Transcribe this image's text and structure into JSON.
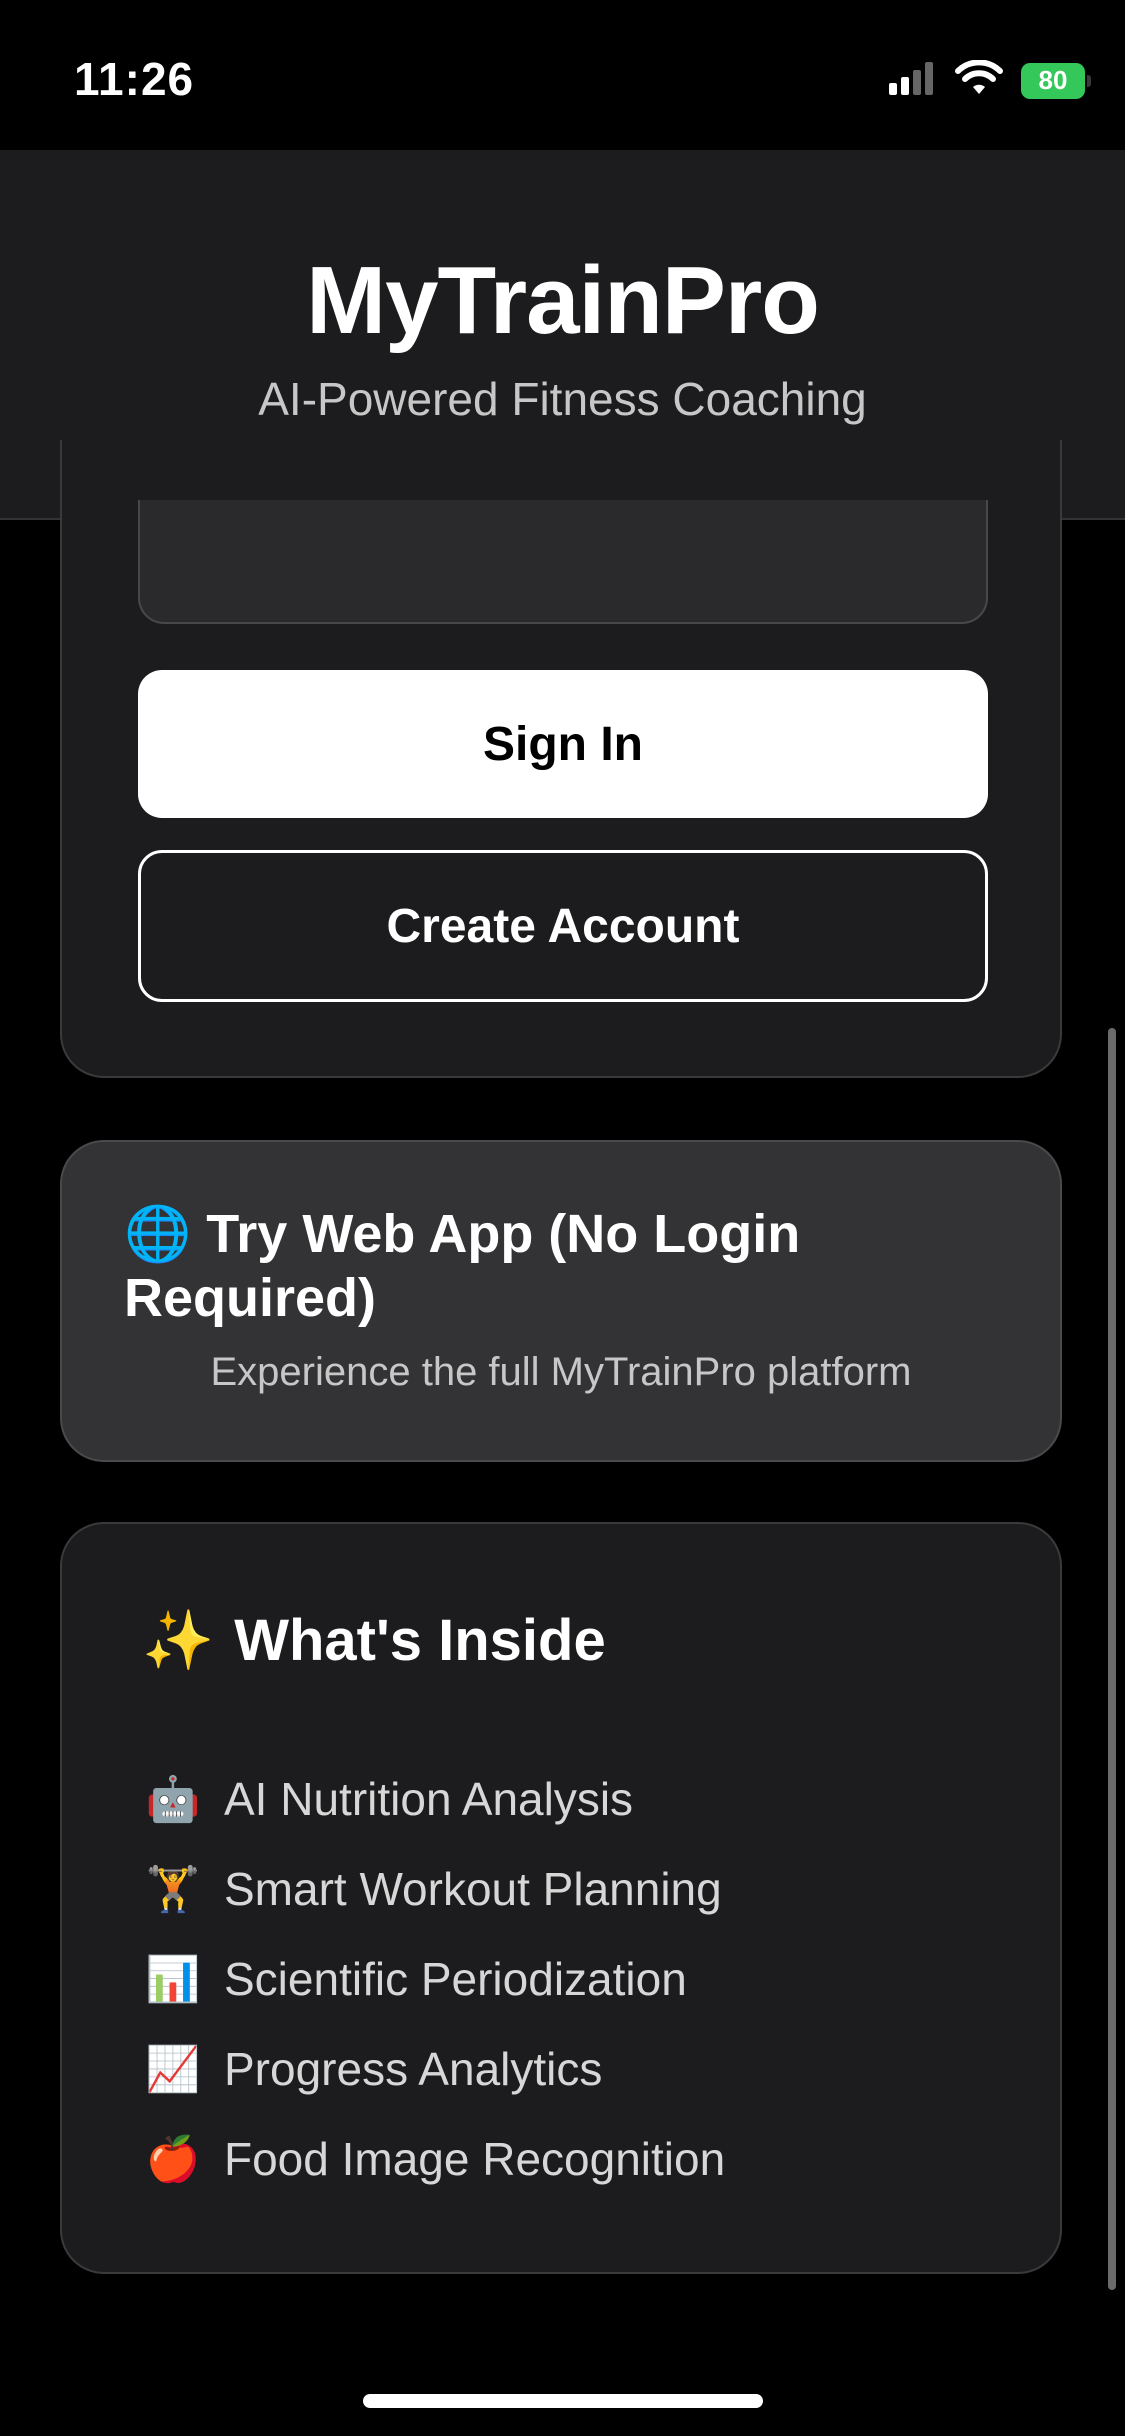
{
  "status": {
    "time": "11:26",
    "battery": "80",
    "signal_icon": "signal-bars-icon",
    "wifi_icon": "wifi-icon"
  },
  "header": {
    "title": "MyTrainPro",
    "subtitle": "AI-Powered Fitness Coaching"
  },
  "login": {
    "sign_in": "Sign In",
    "create_account": "Create Account"
  },
  "webapp": {
    "icon": "🌐",
    "title": "Try Web App (No Login Required)",
    "subtitle": "Experience the full MyTrainPro platform"
  },
  "features": {
    "icon": "✨",
    "title": "What's Inside",
    "items": [
      {
        "icon": "🤖",
        "label": "AI Nutrition Analysis"
      },
      {
        "icon": "🏋",
        "label": "Smart Workout Planning"
      },
      {
        "icon": "📊",
        "label": "Scientific Periodization"
      },
      {
        "icon": "📈",
        "label": "Progress Analytics"
      },
      {
        "icon": "🍎",
        "label": "Food Image Recognition"
      }
    ]
  },
  "colors": {
    "background": "#000000",
    "card": "#1c1c1e",
    "webapp_card": "#333335",
    "battery": "#34c759",
    "primary_button": "#ffffff"
  }
}
